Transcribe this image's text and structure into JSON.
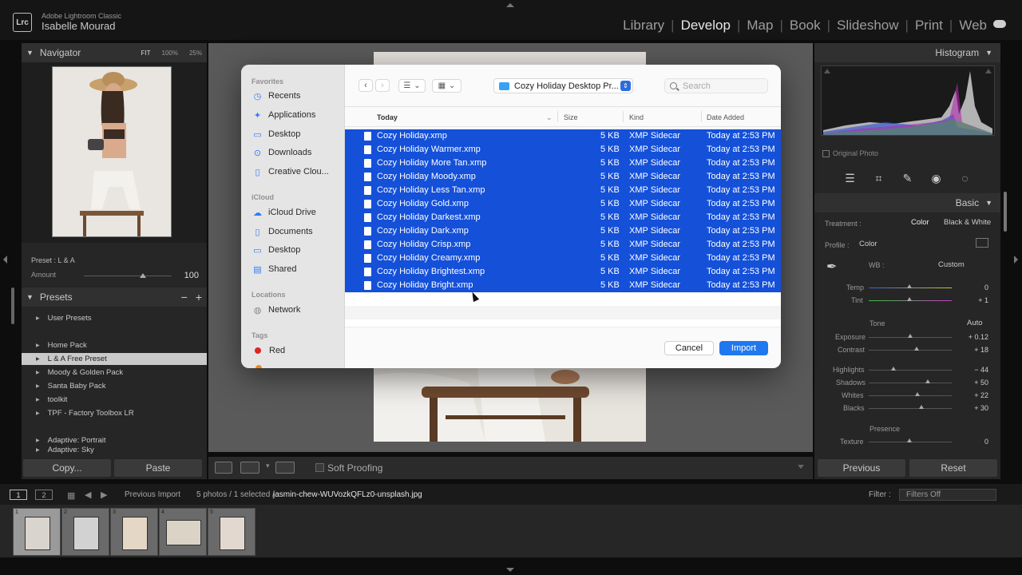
{
  "app": {
    "name": "Adobe Lightroom Classic",
    "user": "Isabelle Mourad",
    "logo": "Lrc"
  },
  "modules": [
    "Library",
    "Develop",
    "Map",
    "Book",
    "Slideshow",
    "Print",
    "Web"
  ],
  "active_module": "Develop",
  "left": {
    "navigator": {
      "title": "Navigator",
      "opts": [
        "FIT",
        "100%",
        "25%"
      ]
    },
    "preset_label": "Preset : L & A",
    "amount_label": "Amount",
    "amount_value": "100",
    "amount_level": 1.0,
    "presets_title": "Presets",
    "presets": [
      "User Presets",
      "Home Pack",
      "L & A Free Preset",
      "Moody & Golden Pack",
      "Santa Baby Pack",
      "toolkit",
      "TPF - Factory Toolbox LR",
      "Adaptive: Portrait",
      "Adaptive: Sky"
    ],
    "selected_preset": "L & A Free Preset",
    "copy_btn": "Copy...",
    "paste_btn": "Paste"
  },
  "toolbar": {
    "soft_proofing": "Soft Proofing"
  },
  "right": {
    "histogram": "Histogram",
    "original_photo": "Original Photo",
    "basic": "Basic",
    "treatment_label": "Treatment :",
    "treatment_color": "Color",
    "treatment_bw": "Black & White",
    "profile_label": "Profile :",
    "profile_value": "Color",
    "wb_label": "WB :",
    "wb_value": "Custom",
    "temp_label": "Temp",
    "temp_val": "0",
    "tint_label": "Tint",
    "tint_val": "+ 1",
    "tone": "Tone",
    "auto": "Auto",
    "exposure_label": "Exposure",
    "exposure_val": "+ 0.12",
    "contrast_label": "Contrast",
    "contrast_val": "+ 18",
    "highlights_label": "Highlights",
    "highlights_val": "− 44",
    "shadows_label": "Shadows",
    "shadows_val": "+ 50",
    "whites_label": "Whites",
    "whites_val": "+ 22",
    "blacks_label": "Blacks",
    "blacks_val": "+ 30",
    "presence": "Presence",
    "texture_label": "Texture",
    "texture_val": "0",
    "previous_btn": "Previous",
    "reset_btn": "Reset"
  },
  "filmbar": {
    "page1": "1",
    "page2": "2",
    "source": "Previous Import",
    "count": "5 photos / 1 selected /",
    "filename": "jasmin-chew-WUVozkQFLz0-unsplash.jpg",
    "filter_label": "Filter :",
    "filter_value": "Filters Off"
  },
  "film_numbers": [
    "1",
    "2",
    "3",
    "4",
    "5"
  ],
  "dialog": {
    "favorites": "Favorites",
    "fav_items": [
      "Recents",
      "Applications",
      "Desktop",
      "Downloads",
      "Creative Clou..."
    ],
    "icloud": "iCloud",
    "icloud_items": [
      "iCloud Drive",
      "Documents",
      "Desktop",
      "Shared"
    ],
    "locations": "Locations",
    "location_items": [
      "Network"
    ],
    "tags": "Tags",
    "tag_items": [
      "Red"
    ],
    "path": "Cozy Holiday Desktop Pr...",
    "search_placeholder": "Search",
    "columns": {
      "name": "Today",
      "size": "Size",
      "kind": "Kind",
      "date": "Date Added"
    },
    "files": [
      {
        "name": "Cozy Holiday.xmp",
        "size": "5 KB",
        "kind": "XMP Sidecar",
        "date": "Today at 2:53 PM"
      },
      {
        "name": "Cozy Holiday Warmer.xmp",
        "size": "5 KB",
        "kind": "XMP Sidecar",
        "date": "Today at 2:53 PM"
      },
      {
        "name": "Cozy Holiday More Tan.xmp",
        "size": "5 KB",
        "kind": "XMP Sidecar",
        "date": "Today at 2:53 PM"
      },
      {
        "name": "Cozy Holiday Moody.xmp",
        "size": "5 KB",
        "kind": "XMP Sidecar",
        "date": "Today at 2:53 PM"
      },
      {
        "name": "Cozy Holiday Less Tan.xmp",
        "size": "5 KB",
        "kind": "XMP Sidecar",
        "date": "Today at 2:53 PM"
      },
      {
        "name": "Cozy Holiday Gold.xmp",
        "size": "5 KB",
        "kind": "XMP Sidecar",
        "date": "Today at 2:53 PM"
      },
      {
        "name": "Cozy Holiday Darkest.xmp",
        "size": "5 KB",
        "kind": "XMP Sidecar",
        "date": "Today at 2:53 PM"
      },
      {
        "name": "Cozy Holiday Dark.xmp",
        "size": "5 KB",
        "kind": "XMP Sidecar",
        "date": "Today at 2:53 PM"
      },
      {
        "name": "Cozy Holiday Crisp.xmp",
        "size": "5 KB",
        "kind": "XMP Sidecar",
        "date": "Today at 2:53 PM"
      },
      {
        "name": "Cozy Holiday Creamy.xmp",
        "size": "5 KB",
        "kind": "XMP Sidecar",
        "date": "Today at 2:53 PM"
      },
      {
        "name": "Cozy Holiday Brightest.xmp",
        "size": "5 KB",
        "kind": "XMP Sidecar",
        "date": "Today at 2:53 PM"
      },
      {
        "name": "Cozy Holiday Bright.xmp",
        "size": "5 KB",
        "kind": "XMP Sidecar",
        "date": "Today at 2:53 PM"
      }
    ],
    "cancel": "Cancel",
    "import": "Import",
    "selection_color": "#1450d8",
    "accent_color": "#1f78f0"
  }
}
